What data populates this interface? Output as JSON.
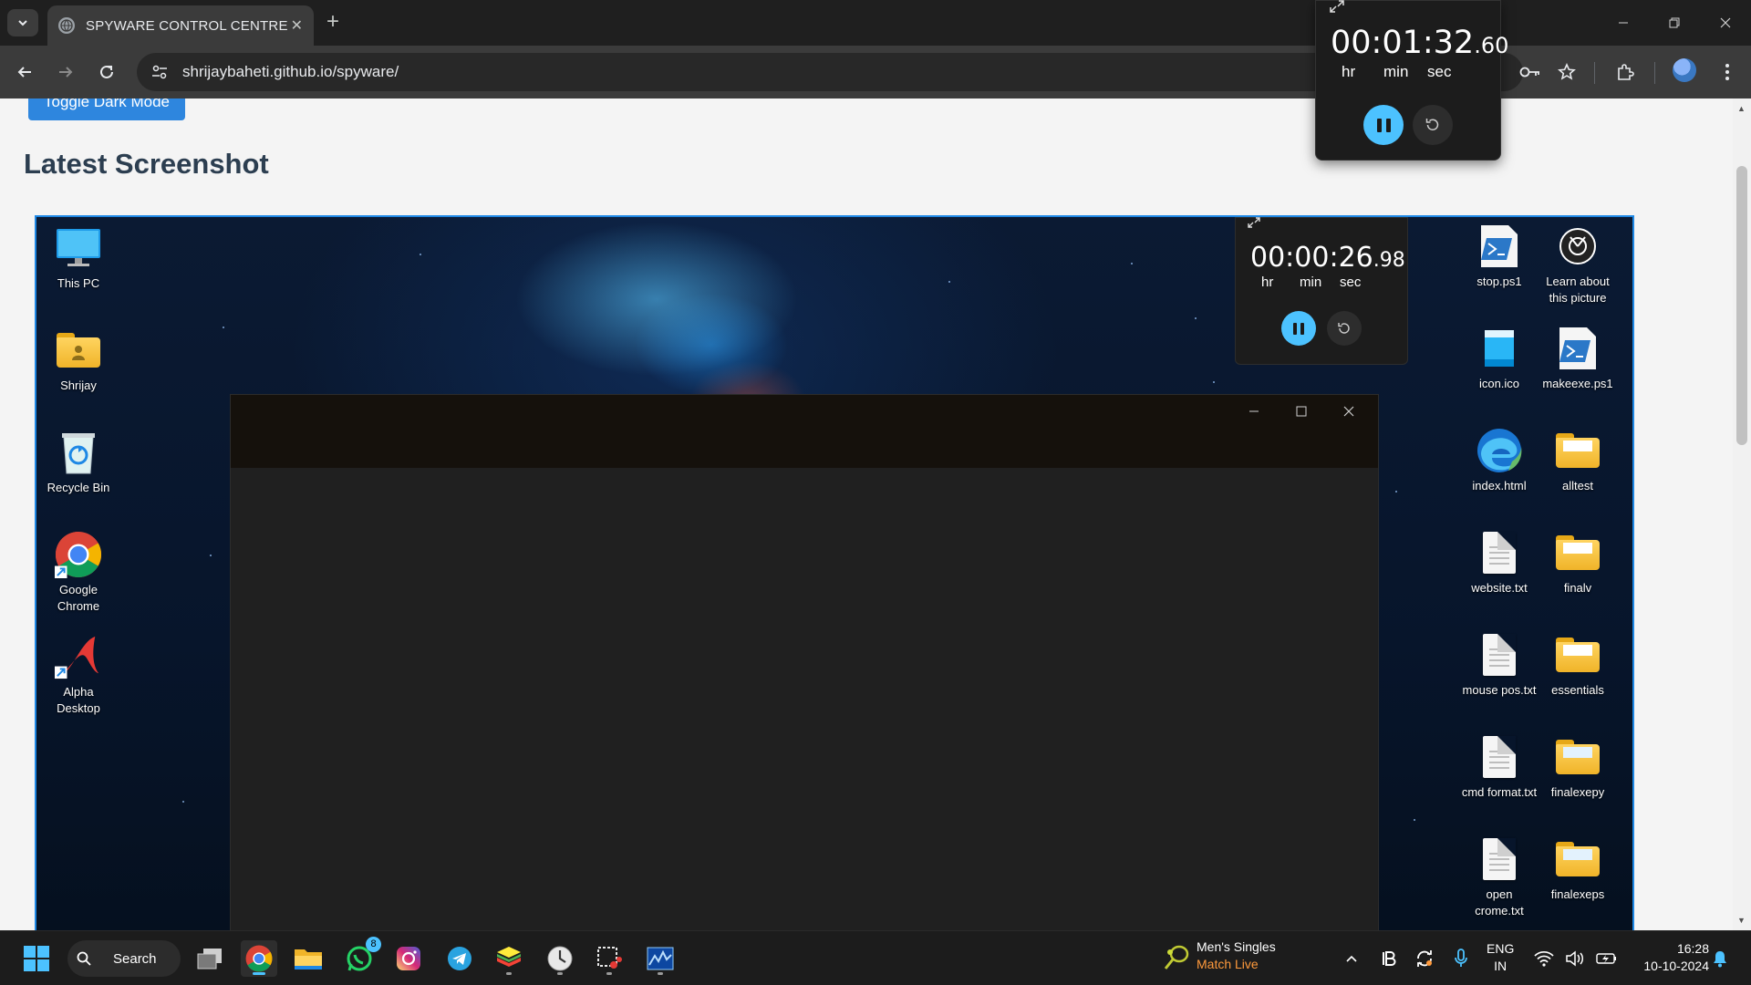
{
  "browser": {
    "tab_title": "SPYWARE CONTROL CENTRE",
    "tab_close": "✕",
    "new_tab": "+",
    "url": "shrijaybaheti.github.io/spyware/"
  },
  "page": {
    "toggle_button": "Toggle Dark Mode",
    "section_title": "Latest Screenshot"
  },
  "stopwatch_top": {
    "hms": "00:01:32",
    "centis": ".60",
    "units": [
      "hr",
      "min",
      "sec"
    ]
  },
  "screenshot": {
    "stopwatch": {
      "hms": "00:00:26",
      "centis": ".98",
      "units": [
        "hr",
        "min",
        "sec"
      ]
    },
    "left_icons": [
      {
        "label": "This PC",
        "icon": "monitor-icon"
      },
      {
        "label": "Shrijay",
        "icon": "user-folder-icon"
      },
      {
        "label": "Recycle Bin",
        "icon": "recycle-bin-icon"
      },
      {
        "label": "Google Chrome",
        "icon": "chrome-icon"
      },
      {
        "label": "Alpha Desktop",
        "icon": "alpha-icon"
      }
    ],
    "right_icons": [
      {
        "label": "stop.ps1",
        "icon": "powershell-icon"
      },
      {
        "label": "Learn about this picture",
        "icon": "camera-icon"
      },
      {
        "label": "icon.ico",
        "icon": "ico-file-icon"
      },
      {
        "label": "makeexe.ps1",
        "icon": "powershell-icon"
      },
      {
        "label": "index.html",
        "icon": "edge-icon"
      },
      {
        "label": "alltest",
        "icon": "folder-icon"
      },
      {
        "label": "website.txt",
        "icon": "text-file-icon"
      },
      {
        "label": "finalv",
        "icon": "folder-icon"
      },
      {
        "label": "mouse pos.txt",
        "icon": "text-file-icon"
      },
      {
        "label": "essentials",
        "icon": "folder-icon"
      },
      {
        "label": "cmd format.txt",
        "icon": "text-file-icon"
      },
      {
        "label": "finalexepy",
        "icon": "folder-icon"
      },
      {
        "label": "open crome.txt",
        "icon": "text-file-icon"
      },
      {
        "label": "finalexeps",
        "icon": "folder-icon"
      }
    ]
  },
  "taskbar": {
    "search_label": "Search",
    "whatsapp_badge": "8",
    "widget_title": "Men's Singles",
    "widget_subtitle": "Match Live",
    "lang_top": "ENG",
    "lang_bottom": "IN",
    "time": "16:28",
    "date": "10-10-2024"
  },
  "colors": {
    "accent": "#2e86de",
    "stopwatch_accent": "#4cc2ff",
    "live_text": "#ff9a3c"
  }
}
